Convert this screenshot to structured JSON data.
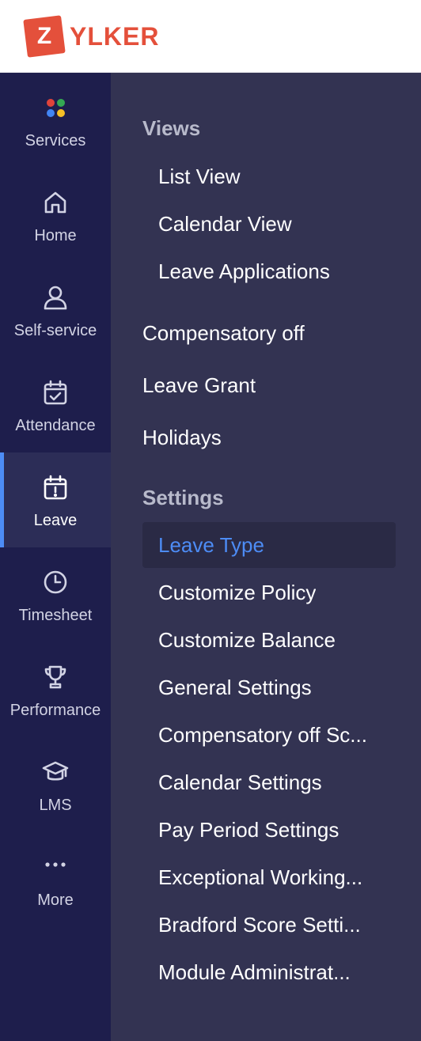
{
  "header": {
    "logo_letter": "Z",
    "logo_rest": "YLKER",
    "brand_color": "#e4503b"
  },
  "rail": {
    "items": [
      {
        "label": "Services",
        "icon": "services-dots-icon"
      },
      {
        "label": "Home",
        "icon": "home-icon"
      },
      {
        "label": "Self-service",
        "icon": "person-icon"
      },
      {
        "label": "Attendance",
        "icon": "calendar-check-icon"
      },
      {
        "label": "Leave",
        "icon": "calendar-alert-icon",
        "active": true
      },
      {
        "label": "Timesheet",
        "icon": "clock-icon"
      },
      {
        "label": "Performance",
        "icon": "trophy-icon"
      },
      {
        "label": "LMS",
        "icon": "graduation-cap-icon"
      },
      {
        "label": "More",
        "icon": "more-dots-icon"
      }
    ],
    "active_accent": "#4d8cf5"
  },
  "panel": {
    "views_title": "Views",
    "views": [
      "List View",
      "Calendar View",
      "Leave Applications"
    ],
    "top_links": [
      "Compensatory off",
      "Leave Grant",
      "Holidays"
    ],
    "settings_title": "Settings",
    "settings": [
      "Leave Type",
      "Customize Policy",
      "Customize Balance",
      "General Settings",
      "Compensatory off Sc...",
      "Calendar Settings",
      "Pay Period Settings",
      "Exceptional Working...",
      "Bradford Score Setti...",
      "Module Administrat..."
    ],
    "active_setting": "Leave Type"
  }
}
